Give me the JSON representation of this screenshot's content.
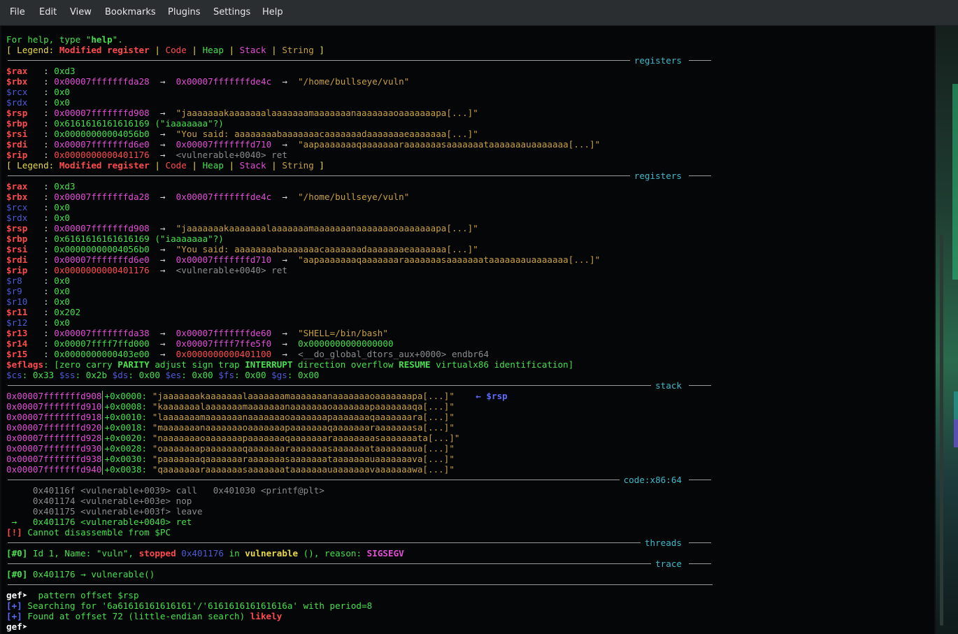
{
  "menu": [
    "File",
    "Edit",
    "View",
    "Bookmarks",
    "Plugins",
    "Settings",
    "Help"
  ],
  "lines": [
    [
      [
        "For help, type \"",
        "grn"
      ],
      [
        "help",
        "grnb"
      ],
      [
        "\".",
        "grn"
      ]
    ],
    [
      [
        "[ Legend: ",
        "yel"
      ],
      [
        "Modified register",
        "redb"
      ],
      [
        " | ",
        "yel"
      ],
      [
        "Code",
        "red"
      ],
      [
        " | ",
        "yel"
      ],
      [
        "Heap",
        "grn"
      ],
      [
        " | ",
        "yel"
      ],
      [
        "Stack",
        "mag"
      ],
      [
        " | ",
        "yel"
      ],
      [
        "String",
        "sz"
      ],
      [
        " ]",
        "yel"
      ]
    ],
    {
      "sep": "registers"
    },
    [
      [
        "$rax",
        "redb"
      ],
      [
        "   : ",
        "wht"
      ],
      [
        "0xd3",
        "grn"
      ]
    ],
    [
      [
        "$rbx",
        "redb"
      ],
      [
        "   : ",
        "wht"
      ],
      [
        "0x00007fffffffda28",
        "mag"
      ],
      [
        "  →  ",
        "wht"
      ],
      [
        "0x00007fffffffde4c",
        "mag"
      ],
      [
        "  →  ",
        "wht"
      ],
      [
        "\"/home/bullseye/vuln\"",
        "sz"
      ]
    ],
    [
      [
        "$rcx",
        "blu"
      ],
      [
        "   : ",
        "wht"
      ],
      [
        "0x0",
        "grn"
      ]
    ],
    [
      [
        "$rdx",
        "blu"
      ],
      [
        "   : ",
        "wht"
      ],
      [
        "0x0",
        "grn"
      ]
    ],
    [
      [
        "$rsp",
        "redb"
      ],
      [
        "   : ",
        "wht"
      ],
      [
        "0x00007fffffffd908",
        "mag"
      ],
      [
        "  →  ",
        "wht"
      ],
      [
        "\"jaaaaaaakaaaaaaalaaaaaaamaaaaaaanaaaaaaaoaaaaaaapa[...]\"",
        "sz"
      ]
    ],
    [
      [
        "$rbp",
        "redb"
      ],
      [
        "   : ",
        "wht"
      ],
      [
        "0x6161616161616169 (\"iaaaaaaa\"?)",
        "grn"
      ]
    ],
    [
      [
        "$rsi",
        "redb"
      ],
      [
        "   : ",
        "wht"
      ],
      [
        "0x00000000004056b0",
        "grn"
      ],
      [
        "  →  ",
        "wht"
      ],
      [
        "\"You said: aaaaaaaabaaaaaaacaaaaaaadaaaaaaaeaaaaaaa[...]\"",
        "sz"
      ]
    ],
    [
      [
        "$rdi",
        "redb"
      ],
      [
        "   : ",
        "wht"
      ],
      [
        "0x00007fffffffd6e0",
        "mag"
      ],
      [
        "  →  ",
        "wht"
      ],
      [
        "0x00007fffffffd710",
        "mag"
      ],
      [
        "  →  ",
        "wht"
      ],
      [
        "\"aapaaaaaaaqaaaaaaaraaaaaaasaaaaaaataaaaaaauaaaaaaa[...]\"",
        "sz"
      ]
    ],
    [
      [
        "$rip",
        "redb"
      ],
      [
        "   : ",
        "wht"
      ],
      [
        "0x0000000000401176",
        "red"
      ],
      [
        "  →  ",
        "wht"
      ],
      [
        "<vulnerable+0040> ret",
        "gry"
      ]
    ],
    [
      [
        "[ Legend: ",
        "yel"
      ],
      [
        "Modified register",
        "redb"
      ],
      [
        " | ",
        "yel"
      ],
      [
        "Code",
        "red"
      ],
      [
        " | ",
        "yel"
      ],
      [
        "Heap",
        "grn"
      ],
      [
        " | ",
        "yel"
      ],
      [
        "Stack",
        "mag"
      ],
      [
        " | ",
        "yel"
      ],
      [
        "String",
        "sz"
      ],
      [
        " ]",
        "yel"
      ]
    ],
    {
      "sep": "registers"
    },
    [
      [
        "$rax",
        "redb"
      ],
      [
        "   : ",
        "wht"
      ],
      [
        "0xd3",
        "grn"
      ]
    ],
    [
      [
        "$rbx",
        "redb"
      ],
      [
        "   : ",
        "wht"
      ],
      [
        "0x00007fffffffda28",
        "mag"
      ],
      [
        "  →  ",
        "wht"
      ],
      [
        "0x00007fffffffde4c",
        "mag"
      ],
      [
        "  →  ",
        "wht"
      ],
      [
        "\"/home/bullseye/vuln\"",
        "sz"
      ]
    ],
    [
      [
        "$rcx",
        "blu"
      ],
      [
        "   : ",
        "wht"
      ],
      [
        "0x0",
        "grn"
      ]
    ],
    [
      [
        "$rdx",
        "blu"
      ],
      [
        "   : ",
        "wht"
      ],
      [
        "0x0",
        "grn"
      ]
    ],
    [
      [
        "$rsp",
        "redb"
      ],
      [
        "   : ",
        "wht"
      ],
      [
        "0x00007fffffffd908",
        "mag"
      ],
      [
        "  →  ",
        "wht"
      ],
      [
        "\"jaaaaaaakaaaaaaalaaaaaaamaaaaaaanaaaaaaaoaaaaaaapa[...]\"",
        "sz"
      ]
    ],
    [
      [
        "$rbp",
        "redb"
      ],
      [
        "   : ",
        "wht"
      ],
      [
        "0x6161616161616169 (\"iaaaaaaa\"?)",
        "grn"
      ]
    ],
    [
      [
        "$rsi",
        "redb"
      ],
      [
        "   : ",
        "wht"
      ],
      [
        "0x00000000004056b0",
        "grn"
      ],
      [
        "  →  ",
        "wht"
      ],
      [
        "\"You said: aaaaaaaabaaaaaaacaaaaaaadaaaaaaaeaaaaaaa[...]\"",
        "sz"
      ]
    ],
    [
      [
        "$rdi",
        "redb"
      ],
      [
        "   : ",
        "wht"
      ],
      [
        "0x00007fffffffd6e0",
        "mag"
      ],
      [
        "  →  ",
        "wht"
      ],
      [
        "0x00007fffffffd710",
        "mag"
      ],
      [
        "  →  ",
        "wht"
      ],
      [
        "\"aapaaaaaaaqaaaaaaaraaaaaaasaaaaaaataaaaaaauaaaaaaa[...]\"",
        "sz"
      ]
    ],
    [
      [
        "$rip",
        "redb"
      ],
      [
        "   : ",
        "wht"
      ],
      [
        "0x0000000000401176",
        "red"
      ],
      [
        "  →  ",
        "wht"
      ],
      [
        "<vulnerable+0040> ret",
        "gry"
      ]
    ],
    [
      [
        "$r8",
        "blu"
      ],
      [
        "    : ",
        "wht"
      ],
      [
        "0x0",
        "grn"
      ]
    ],
    [
      [
        "$r9",
        "blu"
      ],
      [
        "    : ",
        "wht"
      ],
      [
        "0x0",
        "grn"
      ]
    ],
    [
      [
        "$r10",
        "blu"
      ],
      [
        "   : ",
        "wht"
      ],
      [
        "0x0",
        "grn"
      ]
    ],
    [
      [
        "$r11",
        "redb"
      ],
      [
        "   : ",
        "wht"
      ],
      [
        "0x202",
        "grn"
      ]
    ],
    [
      [
        "$r12",
        "blu"
      ],
      [
        "   : ",
        "wht"
      ],
      [
        "0x0",
        "grn"
      ]
    ],
    [
      [
        "$r13",
        "redb"
      ],
      [
        "   : ",
        "wht"
      ],
      [
        "0x00007fffffffda38",
        "mag"
      ],
      [
        "  →  ",
        "wht"
      ],
      [
        "0x00007fffffffde60",
        "mag"
      ],
      [
        "  →  ",
        "wht"
      ],
      [
        "\"SHELL=/bin/bash\"",
        "sz"
      ]
    ],
    [
      [
        "$r14",
        "redb"
      ],
      [
        "   : ",
        "wht"
      ],
      [
        "0x00007ffff7ffd000",
        "grn"
      ],
      [
        "  →  ",
        "wht"
      ],
      [
        "0x00007ffff7ffe5f0",
        "mag"
      ],
      [
        "  →  ",
        "wht"
      ],
      [
        "0x0000000000000000",
        "grn"
      ]
    ],
    [
      [
        "$r15",
        "redb"
      ],
      [
        "   : ",
        "wht"
      ],
      [
        "0x0000000000403e00",
        "grn"
      ],
      [
        "  →  ",
        "wht"
      ],
      [
        "0x0000000000401100",
        "red"
      ],
      [
        "  →  ",
        "wht"
      ],
      [
        "<__do_global_dtors_aux+0000> endbr64",
        "gry"
      ]
    ],
    [
      [
        "$eflags",
        "redb"
      ],
      [
        ": [zero carry ",
        "grn"
      ],
      [
        "PARITY",
        "grnb"
      ],
      [
        " adjust sign trap ",
        "grn"
      ],
      [
        "INTERRUPT",
        "grnb"
      ],
      [
        " direction overflow ",
        "grn"
      ],
      [
        "RESUME",
        "grnb"
      ],
      [
        " virtualx86 identification]",
        "grn"
      ]
    ],
    [
      [
        "$cs",
        "blu"
      ],
      [
        ": 0x33 ",
        "grn"
      ],
      [
        "$ss",
        "blu"
      ],
      [
        ": 0x2b ",
        "grn"
      ],
      [
        "$ds",
        "blu"
      ],
      [
        ": 0x00 ",
        "grn"
      ],
      [
        "$es",
        "blu"
      ],
      [
        ": 0x00 ",
        "grn"
      ],
      [
        "$fs",
        "blu"
      ],
      [
        ": 0x00 ",
        "grn"
      ],
      [
        "$gs",
        "blu"
      ],
      [
        ": 0x00",
        "grn"
      ]
    ],
    {
      "sep": "stack"
    },
    [
      [
        "0x00007fffffffd908",
        "mag"
      ],
      [
        "|bar",
        ""
      ],
      [
        "+0x0000: ",
        "grn"
      ],
      [
        "\"jaaaaaaakaaaaaaalaaaaaaamaaaaaaanaaaaaaaoaaaaaaapa[...]\"",
        "sz"
      ],
      [
        "    ← ",
        "blub"
      ],
      [
        "$rsp",
        "blub"
      ]
    ],
    [
      [
        "0x00007fffffffd910",
        "mag"
      ],
      [
        "|bar",
        ""
      ],
      [
        "+0x0008: ",
        "grn"
      ],
      [
        "\"kaaaaaaalaaaaaaamaaaaaaanaaaaaaaoaaaaaaapaaaaaaaqa[...]\"",
        "sz"
      ]
    ],
    [
      [
        "0x00007fffffffd918",
        "mag"
      ],
      [
        "|bar",
        ""
      ],
      [
        "+0x0010: ",
        "grn"
      ],
      [
        "\"laaaaaaamaaaaaaanaaaaaaaoaaaaaaapaaaaaaaqaaaaaaara[...]\"",
        "sz"
      ]
    ],
    [
      [
        "0x00007fffffffd920",
        "mag"
      ],
      [
        "|bar",
        ""
      ],
      [
        "+0x0018: ",
        "grn"
      ],
      [
        "\"maaaaaaanaaaaaaaoaaaaaaapaaaaaaaqaaaaaaaraaaaaaasa[...]\"",
        "sz"
      ]
    ],
    [
      [
        "0x00007fffffffd928",
        "mag"
      ],
      [
        "|bar",
        ""
      ],
      [
        "+0x0020: ",
        "grn"
      ],
      [
        "\"naaaaaaaoaaaaaaapaaaaaaaqaaaaaaaraaaaaaaasaaaaaaata[...]\"",
        "sz"
      ]
    ],
    [
      [
        "0x00007fffffffd930",
        "mag"
      ],
      [
        "|bar",
        ""
      ],
      [
        "+0x0028: ",
        "grn"
      ],
      [
        "\"oaaaaaaapaaaaaaaqaaaaaaaraaaaaaasaaaaaaataaaaaaaua[...]\"",
        "sz"
      ]
    ],
    [
      [
        "0x00007fffffffd938",
        "mag"
      ],
      [
        "|bar",
        ""
      ],
      [
        "+0x0030: ",
        "grn"
      ],
      [
        "\"paaaaaaaqaaaaaaaraaaaaaasaaaaaaataaaaaaauaaaaaaava[...]\"",
        "sz"
      ]
    ],
    [
      [
        "0x00007fffffffd940",
        "mag"
      ],
      [
        "|bar",
        ""
      ],
      [
        "+0x0038: ",
        "grn"
      ],
      [
        "\"qaaaaaaaraaaaaaasaaaaaaataaaaaaauaaaaaaavaaaaaaawa[...]\"",
        "sz"
      ]
    ],
    {
      "sep": "code:x86:64"
    },
    [
      [
        "     0x40116f <vulnerable+0039> call   0x401030 <printf@plt>",
        "gry"
      ]
    ],
    [
      [
        "     0x401174 <vulnerable+003e> nop",
        "gry"
      ]
    ],
    [
      [
        "     0x401175 <vulnerable+003f> leave",
        "gry"
      ]
    ],
    [
      [
        " →   0x401176 <vulnerable+0040> ret",
        "grn"
      ]
    ],
    [
      [
        "[!]",
        "redb"
      ],
      [
        " Cannot disassemble from $PC",
        "grn"
      ]
    ],
    {
      "sep": "threads"
    },
    [
      [
        "[#0]",
        "grnb"
      ],
      [
        " Id 1, Name: \"vuln\", ",
        "grn"
      ],
      [
        "stopped",
        "redb"
      ],
      [
        " ",
        "grn"
      ],
      [
        "0x401176",
        "blu"
      ],
      [
        " in ",
        "grn"
      ],
      [
        "vulnerable",
        "yelb"
      ],
      [
        " (), reason: ",
        "grn"
      ],
      [
        "SIGSEGV",
        "magb"
      ]
    ],
    {
      "sep": "trace"
    },
    [
      [
        "[#0]",
        "grnb"
      ],
      [
        " 0x401176 → ",
        "grn"
      ],
      [
        "vulnerable()",
        "grn"
      ]
    ],
    {
      "rule": true
    },
    [
      [
        "gef➤",
        "whtb"
      ],
      [
        "  pattern offset $rsp",
        "grn"
      ]
    ],
    [
      [
        "[+]",
        "blub"
      ],
      [
        " Searching for '6a61616161616161'/'616161616161616a' with period=8",
        "grn"
      ]
    ],
    [
      [
        "[+]",
        "blub"
      ],
      [
        " Found at offset 72 (little-endian search) ",
        "grn"
      ],
      [
        "likely",
        "redb"
      ]
    ],
    [
      [
        "gef➤",
        "whtb"
      ],
      [
        "",
        "grn"
      ]
    ]
  ]
}
